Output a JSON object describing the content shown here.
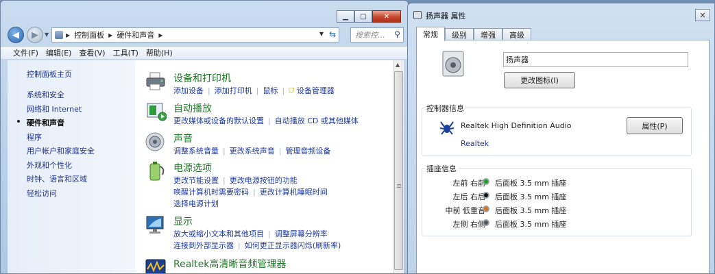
{
  "explorer": {
    "breadcrumb": [
      "控制面板",
      "硬件和声音"
    ],
    "search_placeholder": "搜索控...",
    "menu": [
      "文件(F)",
      "编辑(E)",
      "查看(V)",
      "工具(T)",
      "帮助(H)"
    ],
    "sidebar": {
      "home": "控制面板主页",
      "items": [
        "系统和安全",
        "网络和 Internet",
        "硬件和声音",
        "程序",
        "用户帐户和家庭安全",
        "外观和个性化",
        "时钟、语言和区域",
        "轻松访问"
      ],
      "current_index": 2
    },
    "categories": [
      {
        "title": "设备和打印机",
        "icon": "printer-icon",
        "lines": [
          [
            "添加设备",
            "添加打印机",
            "鼠标",
            "设备管理器"
          ]
        ]
      },
      {
        "title": "自动播放",
        "icon": "autoplay-icon",
        "lines": [
          [
            "更改媒体或设备的默认设置",
            "自动播放 CD 或其他媒体"
          ]
        ]
      },
      {
        "title": "声音",
        "icon": "speaker-icon",
        "lines": [
          [
            "调整系统音量",
            "更改系统声音",
            "管理音频设备"
          ]
        ]
      },
      {
        "title": "电源选项",
        "icon": "battery-icon",
        "lines": [
          [
            "更改节能设置",
            "更改电源按钮的功能"
          ],
          [
            "唤醒计算机时需要密码",
            "更改计算机睡眠时间"
          ],
          [
            "选择电源计划"
          ]
        ]
      },
      {
        "title": "显示",
        "icon": "monitor-icon",
        "lines": [
          [
            "放大或缩小文本和其他项目",
            "调整屏幕分辨率"
          ],
          [
            "连接到外部显示器",
            "如何更正显示器闪烁(刷新率)"
          ]
        ]
      },
      {
        "title": "Realtek高清晰音频管理器",
        "icon": "realtek-manager-icon",
        "lines": []
      }
    ]
  },
  "dialog": {
    "title": "扬声器 属性",
    "tabs": [
      "常规",
      "级别",
      "增强",
      "高级"
    ],
    "device_name": "扬声器",
    "change_icon_label": "更改图标(I)",
    "controller_group": "控制器信息",
    "controller_name": "Realtek High Definition Audio",
    "controller_vendor": "Realtek",
    "properties_label": "属性(P)",
    "jack_group": "插座信息",
    "jacks": [
      {
        "label": "左前 右前",
        "desc": "后面板 3.5 mm 插座",
        "color": "#1aa81a"
      },
      {
        "label": "左后 右后",
        "desc": "后面板 3.5 mm 插座",
        "color": "#111111"
      },
      {
        "label": "中前 低重音",
        "desc": "后面板 3.5 mm 插座",
        "color": "#e07010"
      },
      {
        "label": "左侧 右侧",
        "desc": "后面板 3.5 mm 插座",
        "color": "#555555"
      }
    ]
  }
}
